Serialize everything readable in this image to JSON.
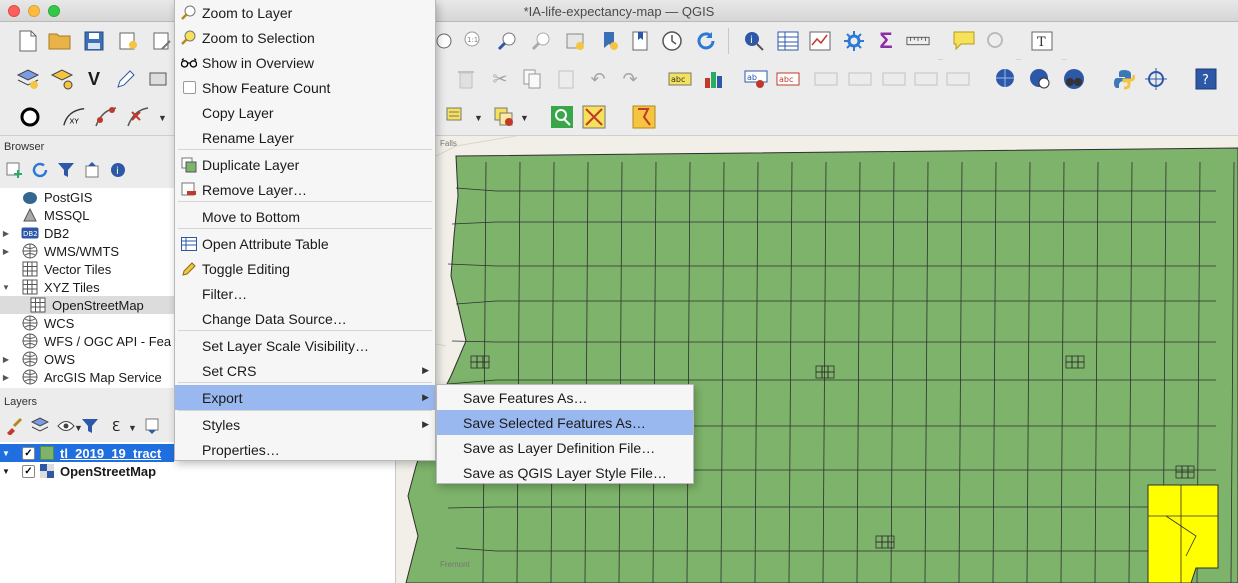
{
  "window": {
    "title": "*IA-life-expectancy-map — QGIS"
  },
  "panels": {
    "browser_title": "Browser",
    "layers_title": "Layers"
  },
  "browser": {
    "items": [
      {
        "label": "PostGIS",
        "icon": "postgis-elephant-icon",
        "expandable": false
      },
      {
        "label": "MSSQL",
        "icon": "mssql-icon",
        "expandable": false
      },
      {
        "label": "DB2",
        "icon": "db2-icon",
        "expandable": true
      },
      {
        "label": "WMS/WMTS",
        "icon": "globe-icon",
        "expandable": true
      },
      {
        "label": "Vector Tiles",
        "icon": "grid-icon",
        "expandable": false
      },
      {
        "label": "XYZ Tiles",
        "icon": "grid-icon",
        "expandable": true
      },
      {
        "label": "OpenStreetMap",
        "icon": "grid-icon",
        "expandable": false,
        "child": true,
        "selected": true
      },
      {
        "label": "WCS",
        "icon": "globe-icon",
        "expandable": false
      },
      {
        "label": "WFS / OGC API - Fea",
        "icon": "globe-icon",
        "expandable": false
      },
      {
        "label": "OWS",
        "icon": "globe-icon",
        "expandable": true
      },
      {
        "label": "ArcGIS Map Service",
        "icon": "globe-icon",
        "expandable": true
      }
    ]
  },
  "layers": {
    "items": [
      {
        "label": "tl_2019_19_tract",
        "checked": true,
        "selected": true,
        "swatch_color": "#7db36a"
      },
      {
        "label": "OpenStreetMap",
        "checked": true,
        "selected": false
      }
    ]
  },
  "context_menu": {
    "items": [
      {
        "label": "Zoom to Layer",
        "icon": "zoom-layer-icon"
      },
      {
        "label": "Zoom to Selection",
        "icon": "zoom-selection-icon"
      },
      {
        "label": "Show in Overview",
        "icon": "overview-glasses-icon"
      },
      {
        "label": "Show Feature Count",
        "icon": "checkbox-icon"
      },
      {
        "label": "Copy Layer",
        "icon": ""
      },
      {
        "label": "Rename Layer",
        "icon": ""
      },
      {
        "label": "Duplicate Layer",
        "icon": "duplicate-layer-icon"
      },
      {
        "label": "Remove Layer…",
        "icon": "remove-layer-icon"
      },
      {
        "label": "Move to Bottom",
        "icon": ""
      },
      {
        "label": "Open Attribute Table",
        "icon": "attribute-table-icon"
      },
      {
        "label": "Toggle Editing",
        "icon": "pencil-icon"
      },
      {
        "label": "Filter…",
        "icon": ""
      },
      {
        "label": "Change Data Source…",
        "icon": ""
      },
      {
        "label": "Set Layer Scale Visibility…",
        "icon": ""
      },
      {
        "label": "Set CRS",
        "icon": "",
        "submenu": true
      },
      {
        "label": "Export",
        "icon": "",
        "submenu": true,
        "active": true
      },
      {
        "label": "Styles",
        "icon": "",
        "submenu": true
      },
      {
        "label": "Properties…",
        "icon": ""
      }
    ]
  },
  "export_submenu": {
    "items": [
      {
        "label": "Save Features As…"
      },
      {
        "label": "Save Selected Features As…",
        "active": true
      },
      {
        "label": "Save as Layer Definition File…"
      },
      {
        "label": "Save as QGIS Layer Style File…"
      }
    ]
  },
  "map": {
    "fill_color": "#7db36a",
    "border_color": "#2f2f2f",
    "selected_color": "#ffff00",
    "background_color": "#f2efe9",
    "place_labels": [
      "Falls",
      "Fremont"
    ]
  },
  "colors": {
    "menu_highlight": "#9ab8f0",
    "layer_selection": "#1f6fe0"
  }
}
